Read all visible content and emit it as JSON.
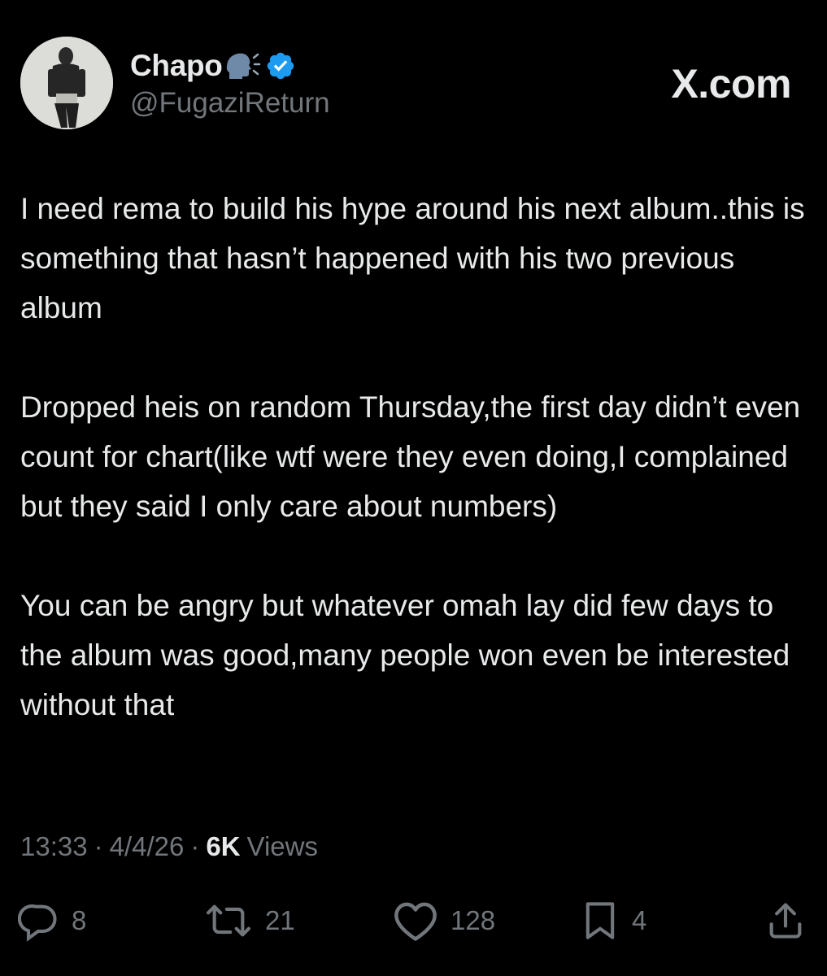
{
  "author": {
    "display_name": "Chapo",
    "handle": "@FugaziReturn",
    "verified": true,
    "name_emoji": "speaking-head-icon",
    "verified_icon": "verified-badge-icon"
  },
  "brand": {
    "logo_text": "X.com"
  },
  "tweet": {
    "paragraphs": [
      "I need rema to build his hype around his next album..this is something that hasn’t happened with his two previous album",
      "Dropped heis on random Thursday,the first day didn’t even count for chart(like wtf were they even doing,I complained but they said I only care about numbers)",
      "You can be angry but whatever omah lay did few days to the album was good,many people won even be interested without that"
    ]
  },
  "meta": {
    "time": "13:33",
    "separator": "·",
    "date": "4/4/26",
    "views_count": "6K",
    "views_label": "Views"
  },
  "actions": {
    "replies": "8",
    "reposts": "21",
    "likes": "128",
    "bookmarks": "4",
    "icons": [
      "reply-icon",
      "repost-icon",
      "like-icon",
      "bookmark-icon",
      "share-icon"
    ]
  },
  "colors": {
    "background": "#000000",
    "primary_text": "#e7e9ea",
    "secondary_text": "#71767b",
    "verified_blue": "#1d9bf0"
  }
}
